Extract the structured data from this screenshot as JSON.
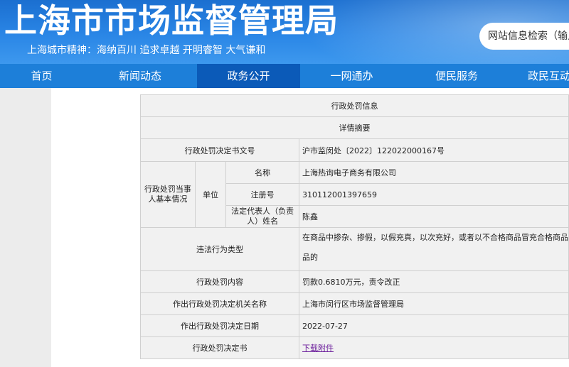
{
  "header": {
    "site_title": "上海市市场监督管理局",
    "spirit": "上海城市精神：海纳百川    追求卓越    开明睿智    大气谦和",
    "search_placeholder": "网站信息检索（输入"
  },
  "nav": {
    "items": [
      "首页",
      "新闻动态",
      "政务公开",
      "一网通办",
      "便民服务",
      "政民互动"
    ],
    "active_index": 2
  },
  "table": {
    "title": "行政处罚信息",
    "summary": "详情摘要",
    "doc_no_label": "行政处罚决定书文号",
    "doc_no_value": "沪市监闵处〔2022〕122022000167号",
    "party_label": "行政处罚当事人基本情况",
    "unit_label": "单位",
    "name_label": "名称",
    "name_value": "上海热询电子商务有限公司",
    "reg_label": "注册号",
    "reg_value": "310112001397659",
    "rep_label": "法定代表人（负责人）姓名",
    "rep_value": "陈鑫",
    "violation_label": "违法行为类型",
    "violation_line1": "在商品中掺杂、掺假，以假充真，以次充好，或者以不合格商品冒充合格商品",
    "violation_line2": "品的",
    "content_label": "行政处罚内容",
    "content_value": "罚款0.6810万元，责令改正",
    "authority_label": "作出行政处罚决定机关名称",
    "authority_value": "上海市闵行区市场监督管理局",
    "date_label": "作出行政处罚决定日期",
    "date_value": "2022-07-27",
    "decision_label": "行政处罚决定书",
    "decision_link": "下载附件"
  }
}
